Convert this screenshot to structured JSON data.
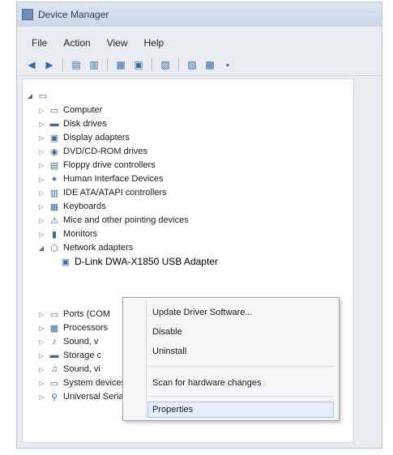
{
  "window": {
    "title": "Device Manager"
  },
  "menu": [
    "File",
    "Action",
    "View",
    "Help"
  ],
  "toolbar": {
    "icons": [
      "back-icon",
      "forward-icon",
      "properties-icon",
      "refresh-icon",
      "help-icon",
      "view-icon",
      "scan-icon",
      "update-driver-icon",
      "disable-icon",
      "uninstall-icon"
    ]
  },
  "tree": {
    "root": "",
    "items": [
      {
        "label": "Computer"
      },
      {
        "label": "Disk drives"
      },
      {
        "label": "Display adapters"
      },
      {
        "label": "DVD/CD-ROM drives"
      },
      {
        "label": "Floppy drive controllers"
      },
      {
        "label": "Human Interface Devices"
      },
      {
        "label": "IDE ATA/ATAPI controllers"
      },
      {
        "label": "Keyboards"
      },
      {
        "label": "Mice and other pointing devices"
      },
      {
        "label": "Monitors"
      },
      {
        "label": "Network adapters"
      }
    ],
    "adapter": "D-Link DWA-X1850 USB Adapter",
    "below": [
      {
        "label": "Ports (COM"
      },
      {
        "label": "Processors"
      },
      {
        "label": "Sound, v"
      },
      {
        "label": "Storage c"
      },
      {
        "label": "Sound, vi"
      },
      {
        "label": "System devices"
      },
      {
        "label": "Universal Serial Bus controllers"
      }
    ]
  },
  "context_menu": {
    "items": [
      "Update Driver Software...",
      "Disable",
      "Uninstall",
      "Scan for hardware changes",
      "Properties"
    ],
    "highlighted": "Properties"
  }
}
